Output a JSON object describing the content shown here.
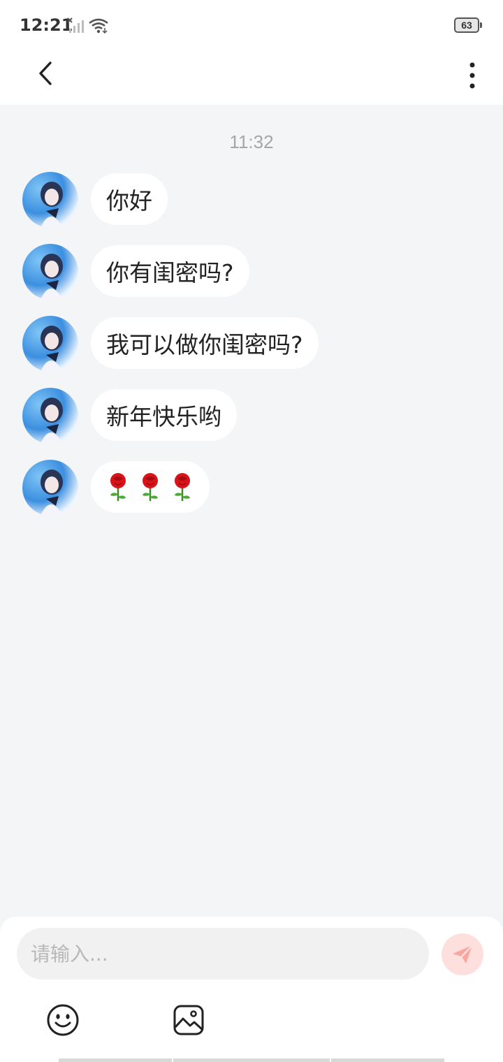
{
  "status_bar": {
    "time": "12:21",
    "battery": "63",
    "icons": [
      "signal-icon",
      "wifi-icon",
      "battery-icon"
    ]
  },
  "header": {
    "back_icon": "chevron-left-icon",
    "more_icon": "vertical-dots-icon"
  },
  "chat": {
    "timestamp": "11:32",
    "messages": [
      {
        "sender": "other",
        "text": "你好"
      },
      {
        "sender": "other",
        "text": "你有闺密吗?"
      },
      {
        "sender": "other",
        "text": "我可以做你闺密吗?"
      },
      {
        "sender": "other",
        "text": "新年快乐哟"
      },
      {
        "sender": "other",
        "text": "🌹🌹🌹",
        "emoji": [
          "rose-icon",
          "rose-icon",
          "rose-icon"
        ]
      }
    ]
  },
  "composer": {
    "placeholder": "请输入...",
    "value": "",
    "send_icon": "paper-plane-icon",
    "tools": [
      "smiley-icon",
      "image-icon"
    ]
  },
  "colors": {
    "background": "#f4f5f7",
    "bubble": "#ffffff",
    "send_button": "#fde0dd",
    "send_icon": "#f7a79d",
    "timestamp": "#a6a6a6"
  }
}
